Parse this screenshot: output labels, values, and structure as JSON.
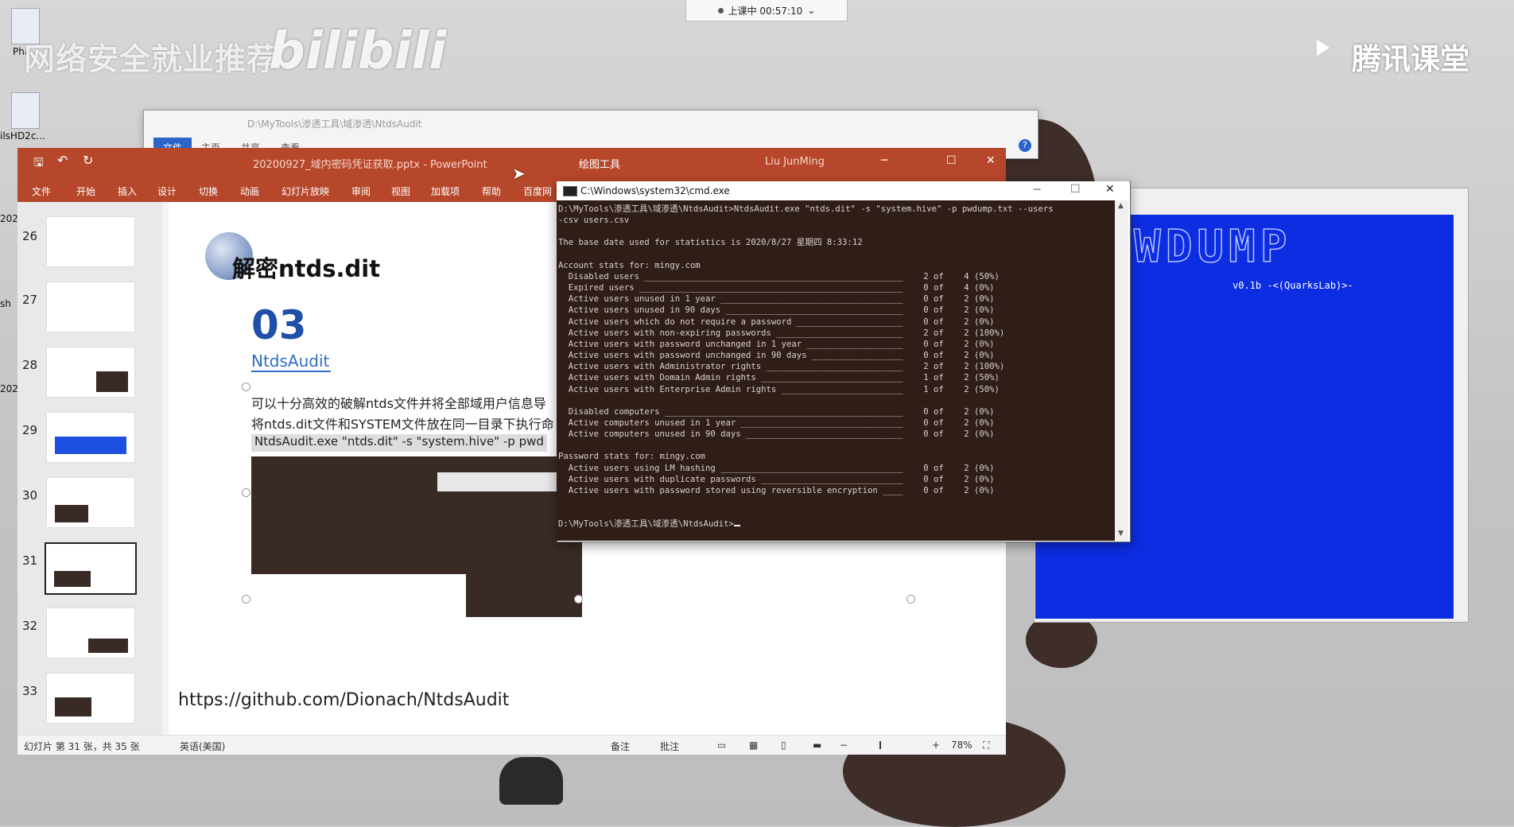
{
  "watermark": {
    "left_text": "网络安全就业推荐",
    "bili": "bilibili",
    "right_text": "腾讯课堂"
  },
  "class_status": {
    "label": "上课中 00:57:10",
    "chevron": "chevron-down"
  },
  "desktop_icons": [
    {
      "label": "Pha..."
    },
    {
      "label": "ilsHD2c..."
    },
    {
      "label": "202"
    },
    {
      "label": "sh"
    },
    {
      "label": "202"
    }
  ],
  "explorer": {
    "path": "D:\\MyTools\\渗透工具\\域渗透\\NtdsAudit",
    "tabs": [
      "文件",
      "主页",
      "共享",
      "查看"
    ]
  },
  "ppt": {
    "title": "20200927_域内密码凭证获取.pptx  -  PowerPoint",
    "tool_context": "绘图工具",
    "user": "Liu JunMing",
    "ribbon": [
      "文件",
      "开始",
      "插入",
      "设计",
      "切换",
      "动画",
      "幻灯片放映",
      "审阅",
      "视图",
      "加载项",
      "帮助",
      "百度网"
    ],
    "thumb_numbers": [
      "26",
      "27",
      "28",
      "29",
      "30",
      "31",
      "32",
      "33"
    ],
    "status_slide": "幻灯片 第 31 张，共 35 张",
    "status_lang": "英语(美国)",
    "status_notes": "备注",
    "status_comments": "批注",
    "zoom": "78%",
    "zoom_minus": "−",
    "zoom_plus": "+"
  },
  "slide": {
    "title": "解密ntds.dit",
    "number": "03",
    "subtitle": "NtdsAudit",
    "line1": "可以十分高效的破解ntds文件并将全部域用户信息导",
    "line2": "将ntds.dit文件和SYSTEM文件放在同一目录下执行命",
    "cmd": "NtdsAudit.exe \"ntds.dit\" -s \"system.hive\" -p pwd",
    "url": "https://github.com/Dionach/NtdsAudit"
  },
  "cmd": {
    "title": "C:\\Windows\\system32\\cmd.exe",
    "lines": [
      "D:\\MyTools\\渗透工具\\域渗透\\NtdsAudit>NtdsAudit.exe \"ntds.dit\" -s \"system.hive\" -p pwdump.txt --users",
      "-csv users.csv",
      "",
      "The base date used for statistics is 2020/8/27 星期四 8:33:12",
      "",
      "Account stats for: mingy.com",
      "  Disabled users ___________________________________________________    2 of    4 (50%)",
      "  Expired users ____________________________________________________    0 of    4 (0%)",
      "  Active users unused in 1 year ____________________________________    0 of    2 (0%)",
      "  Active users unused in 90 days ___________________________________    0 of    2 (0%)",
      "  Active users which do not require a password _____________________    0 of    2 (0%)",
      "  Active users with non-expiring passwords _________________________    2 of    2 (100%)",
      "  Active users with password unchanged in 1 year ___________________    0 of    2 (0%)",
      "  Active users with password unchanged in 90 days __________________    0 of    2 (0%)",
      "  Active users with Administrator rights ___________________________    2 of    2 (100%)",
      "  Active users with Domain Admin rights ____________________________    1 of    2 (50%)",
      "  Active users with Enterprise Admin rights ________________________    1 of    2 (50%)",
      "",
      "  Disabled computers _______________________________________________    0 of    2 (0%)",
      "  Active computers unused in 1 year ________________________________    0 of    2 (0%)",
      "  Active computers unused in 90 days _______________________________    0 of    2 (0%)",
      "",
      "Password stats for: mingy.com",
      "  Active users using LM hashing ____________________________________    0 of    2 (0%)",
      "  Active users with duplicate passwords ____________________________    0 of    2 (0%)",
      "  Active users with password stored using reversible encryption ____    0 of    2 (0%)",
      "",
      ""
    ],
    "prompt": "D:\\MyTools\\渗透工具\\域渗透\\NtdsAudit>"
  },
  "blue_window": {
    "art": "WDUMP",
    "version": "v0.1b -<(QuarksLab)>-"
  }
}
